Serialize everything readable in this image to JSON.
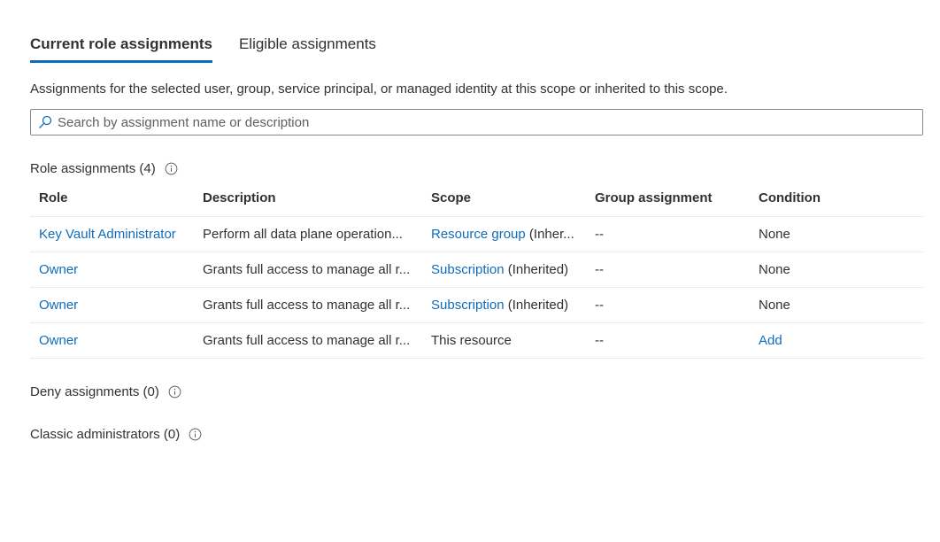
{
  "tabs": [
    {
      "label": "Current role assignments",
      "active": true
    },
    {
      "label": "Eligible assignments",
      "active": false
    }
  ],
  "description": "Assignments for the selected user, group, service principal, or managed identity at this scope or inherited to this scope.",
  "search": {
    "placeholder": "Search by assignment name or description",
    "value": ""
  },
  "role_assignments": {
    "title": "Role assignments (4)",
    "columns": [
      "Role",
      "Description",
      "Scope",
      "Group assignment",
      "Condition"
    ],
    "rows": [
      {
        "role": "Key Vault Administrator",
        "description": "Perform all data plane operation...",
        "scope_link": "Resource group",
        "scope_suffix": " (Inher...",
        "group": "--",
        "condition": "None",
        "condition_is_link": false
      },
      {
        "role": "Owner",
        "description": "Grants full access to manage all r...",
        "scope_link": "Subscription",
        "scope_suffix": " (Inherited)",
        "group": "--",
        "condition": "None",
        "condition_is_link": false
      },
      {
        "role": "Owner",
        "description": "Grants full access to manage all r...",
        "scope_link": "Subscription",
        "scope_suffix": " (Inherited)",
        "group": "--",
        "condition": "None",
        "condition_is_link": false
      },
      {
        "role": "Owner",
        "description": "Grants full access to manage all r...",
        "scope_link": "",
        "scope_suffix": "This resource",
        "group": "--",
        "condition": "Add",
        "condition_is_link": true
      }
    ]
  },
  "deny_assignments": {
    "title": "Deny assignments (0)"
  },
  "classic_administrators": {
    "title": "Classic administrators (0)"
  },
  "colors": {
    "accent": "#0f6cbd",
    "text": "#323130",
    "divider": "#edebe9"
  }
}
